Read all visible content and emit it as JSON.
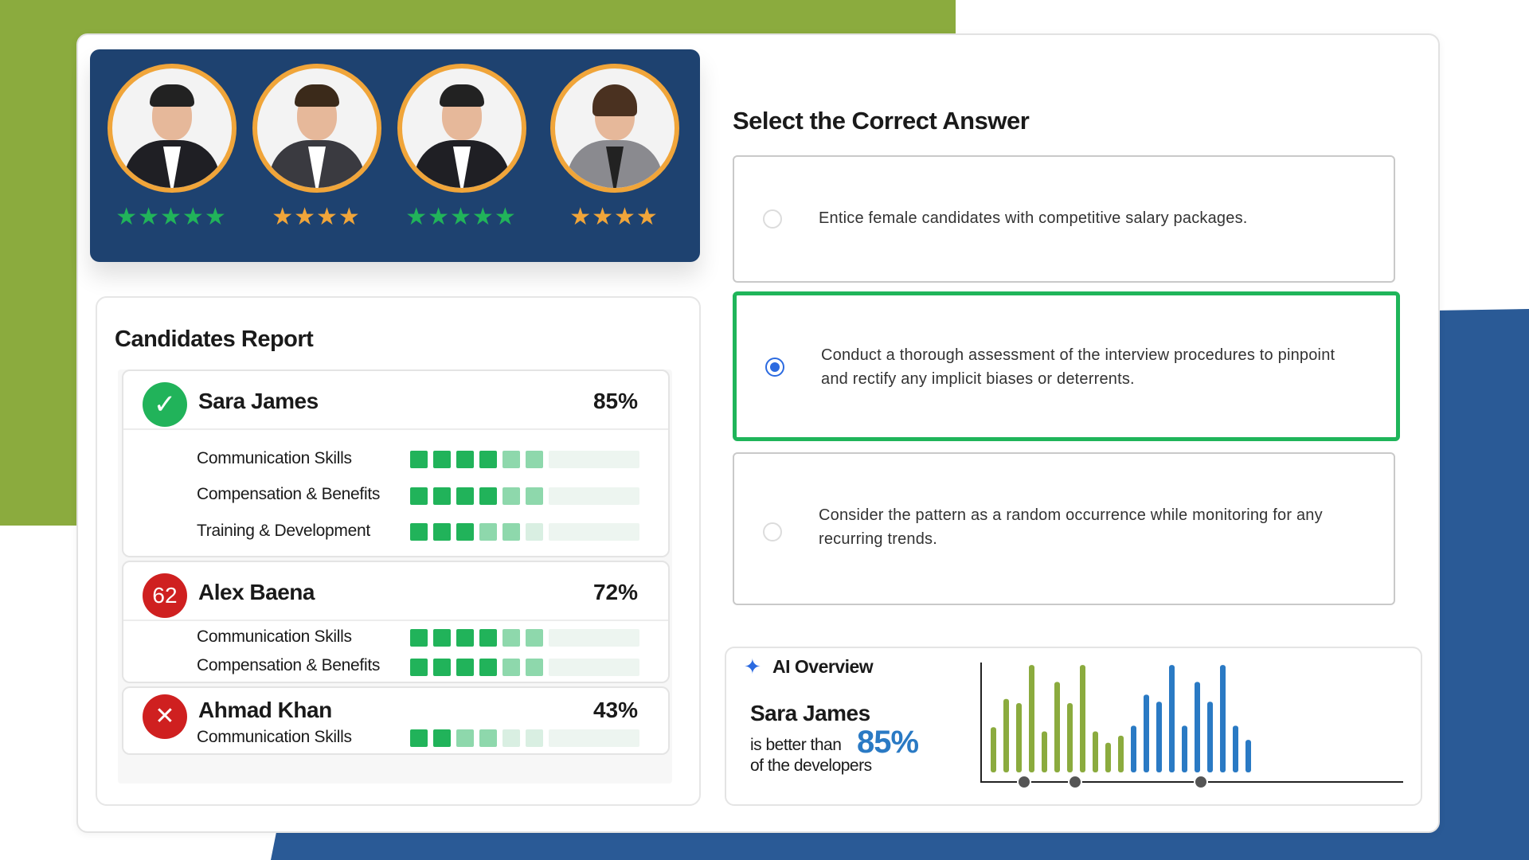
{
  "candidates_panel": {
    "avatars": [
      {
        "stars": "★★★★★",
        "star_color": "#21b35a"
      },
      {
        "stars": "★★★★",
        "star_color": "#f0a53a"
      },
      {
        "stars": "★★★★★",
        "star_color": "#21b35a"
      },
      {
        "stars": "★★★★",
        "star_color": "#f0a53a"
      }
    ]
  },
  "report": {
    "title": "Candidates Report",
    "candidates": [
      {
        "name": "Sara James",
        "score": "85%",
        "badge_icon": "check-icon",
        "badge_glyph": "✓",
        "badge_color": "#21b35a",
        "skills": [
          {
            "label": "Communication Skills",
            "level": 4.5
          },
          {
            "label": "Compensation & Benefits",
            "level": 4
          },
          {
            "label": "Training & Development",
            "level": 3
          }
        ]
      },
      {
        "name": "Alex Baena",
        "score": "72%",
        "badge_text": "62",
        "badge_color": "#cf2020",
        "skills": [
          {
            "label": "Communication Skills",
            "level": 4
          },
          {
            "label": "Compensation & Benefits",
            "level": 4
          }
        ]
      },
      {
        "name": "Ahmad Khan",
        "score": "43%",
        "badge_icon": "close-icon",
        "badge_glyph": "✕",
        "badge_color": "#cf2020",
        "skills": [
          {
            "label": "Communication Skills",
            "level": 2
          }
        ]
      }
    ]
  },
  "question": {
    "title": "Select the Correct Answer",
    "options": [
      {
        "text": "Entice female candidates with competitive salary packages.",
        "selected": false
      },
      {
        "text": "Conduct a thorough assessment of the interview procedures to pinpoint and rectify any implicit biases or deterrents.",
        "selected": true
      },
      {
        "text": "Consider the pattern as a random occurrence while monitoring for any recurring trends.",
        "selected": false
      }
    ]
  },
  "ai_overview": {
    "label": "AI Overview",
    "name": "Sara James",
    "text_before": "is better than",
    "percent": "85%",
    "text_after": "of the developers"
  },
  "chart_data": {
    "type": "bar",
    "series": [
      {
        "color": "#8bab3e",
        "values": [
          3.2,
          5.2,
          4.9,
          7.6,
          2.9,
          6.4,
          4.9,
          7.6,
          2.9,
          2.1,
          2.6
        ]
      },
      {
        "color": "#2a7ac4",
        "values": [
          3.3,
          5.5,
          5.0,
          7.6,
          3.3,
          6.4,
          5.0,
          7.6,
          3.3,
          2.3
        ]
      }
    ],
    "ylim": [
      0,
      8
    ],
    "grid": false
  },
  "colors": {
    "accent_green": "#21b35a",
    "accent_blue": "#2b6ae0",
    "avatar_ring": "#f0a53a",
    "panel_navy": "#1e4270"
  }
}
